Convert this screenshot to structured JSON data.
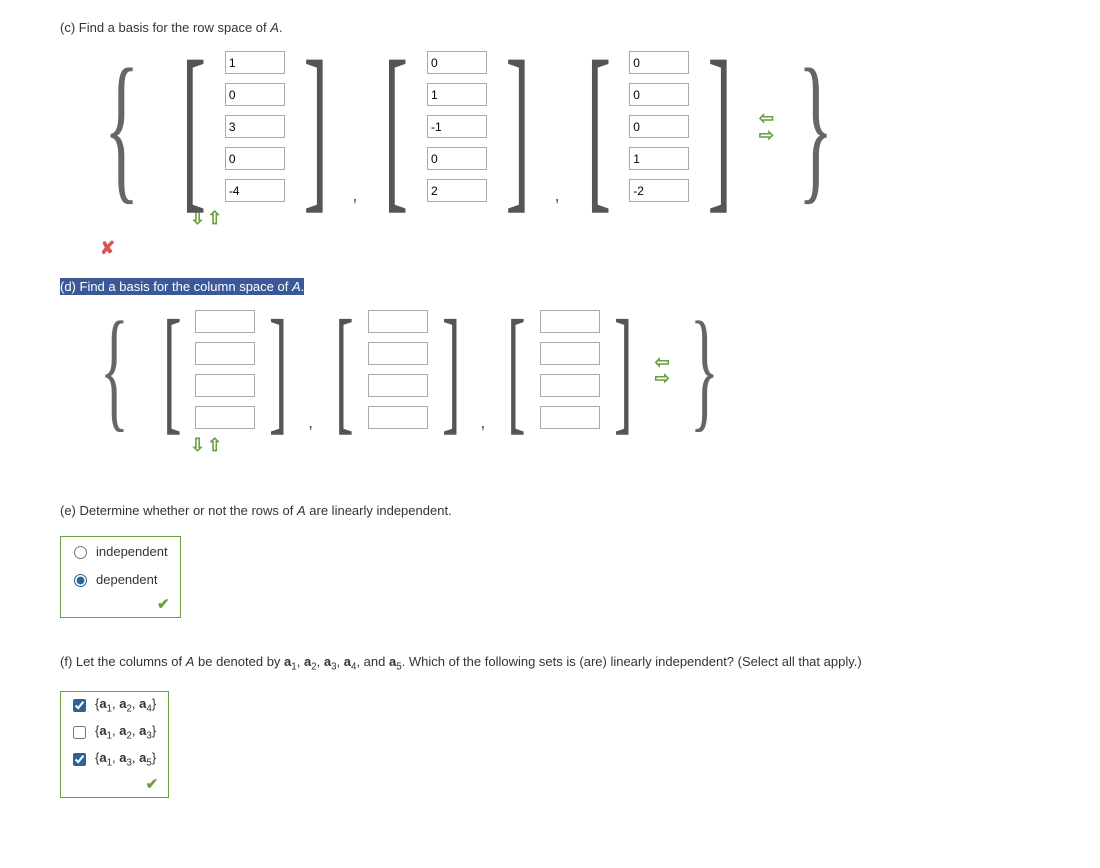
{
  "part_c": {
    "label_prefix": "(c) Find a basis for the row space of ",
    "italic": "A",
    "label_suffix": ".",
    "status": "incorrect",
    "vectors": [
      [
        "1",
        "0",
        "3",
        "0",
        "-4"
      ],
      [
        "0",
        "1",
        "-1",
        "0",
        "2"
      ],
      [
        "0",
        "0",
        "0",
        "1",
        "-2"
      ]
    ]
  },
  "part_d": {
    "label_prefix": "(d) Find a basis for the column space of ",
    "italic": "A",
    "label_suffix": ".",
    "vectors": [
      [
        "",
        "",
        "",
        ""
      ],
      [
        "",
        "",
        "",
        ""
      ],
      [
        "",
        "",
        "",
        ""
      ]
    ]
  },
  "part_e": {
    "label_prefix": "(e) Determine whether or not the rows of ",
    "italic": "A",
    "label_suffix": " are linearly independent.",
    "options": [
      {
        "label": "independent",
        "checked": false
      },
      {
        "label": "dependent",
        "checked": true
      }
    ],
    "status": "correct"
  },
  "part_f": {
    "label_prefix": "(f) Let the columns of ",
    "italic": "A",
    "label_mid": " be denoted by ",
    "label_suffix": ". Which of the following sets is (are) linearly independent? (Select all that apply.)",
    "col_labels": [
      "a1",
      "a2",
      "a3",
      "a4",
      "a5"
    ],
    "options": [
      {
        "set": [
          "a1",
          "a2",
          "a4"
        ],
        "checked": true
      },
      {
        "set": [
          "a1",
          "a2",
          "a3"
        ],
        "checked": false
      },
      {
        "set": [
          "a1",
          "a3",
          "a5"
        ],
        "checked": true
      }
    ],
    "status": "correct"
  }
}
